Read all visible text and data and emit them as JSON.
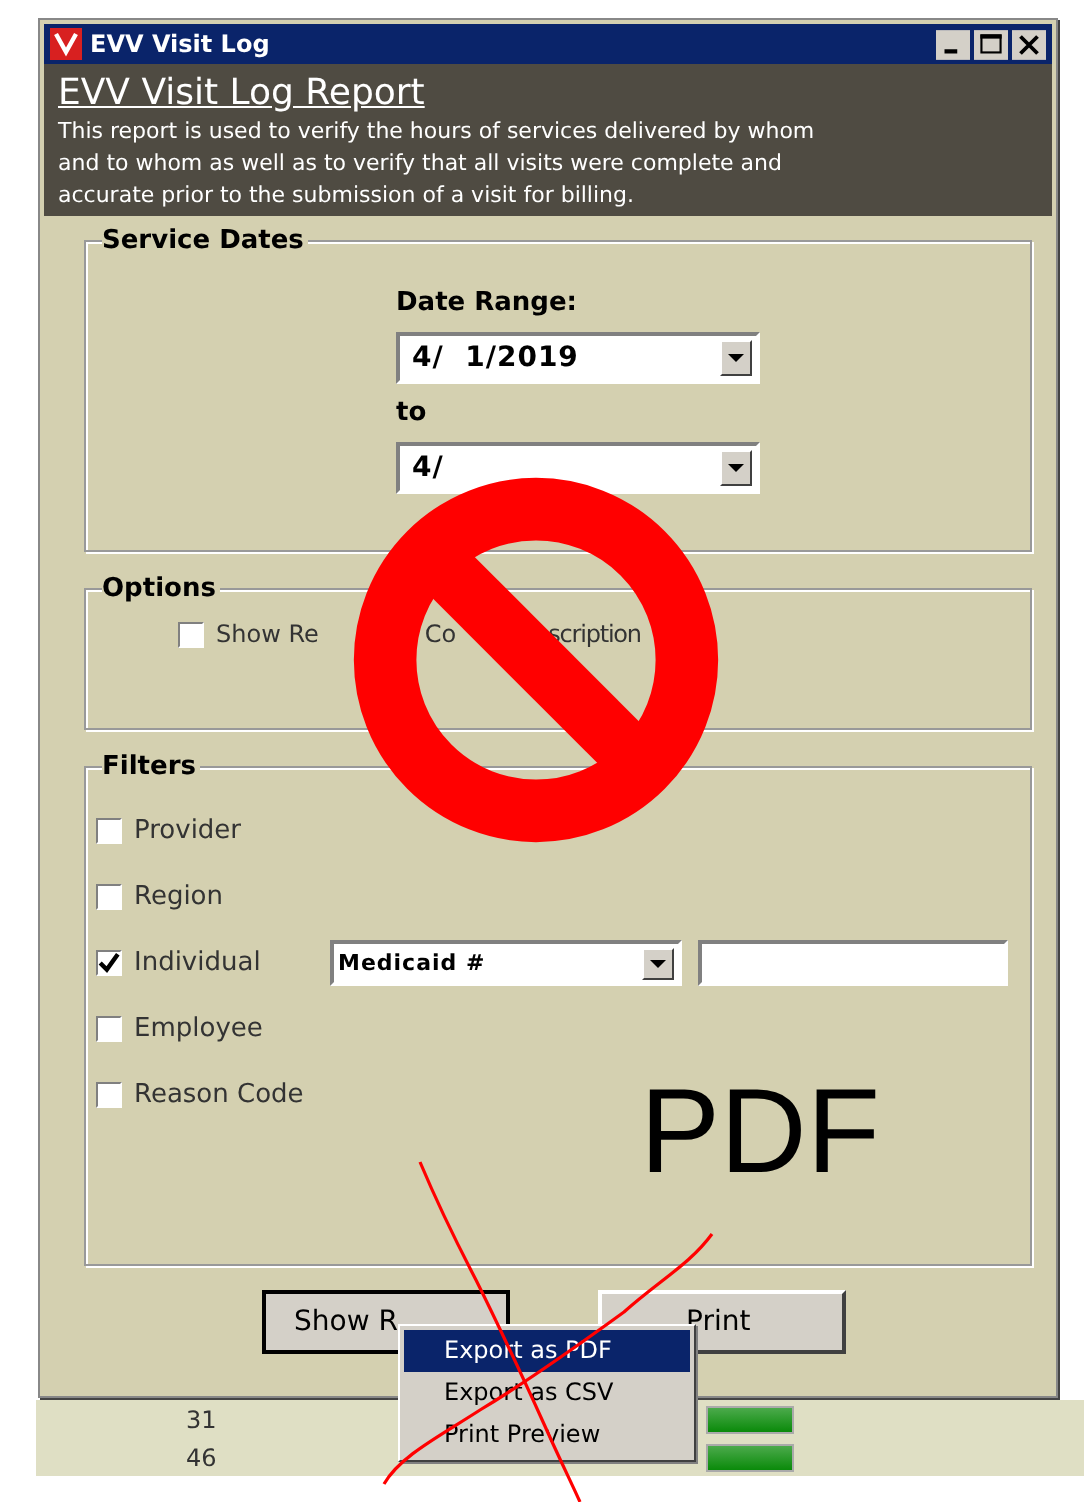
{
  "window": {
    "title": "EVV Visit Log"
  },
  "header": {
    "title": "EVV Visit Log Report",
    "description": "This report is used to verify the hours of services delivered by whom and to whom as well as to verify that all visits were complete and accurate prior to the submission of a visit for billing."
  },
  "service_dates": {
    "title": "Service Dates",
    "range_label": "Date Range:",
    "to_label": "to",
    "dates": [
      {
        "value": "4/  1/2019"
      },
      {
        "value": "4/"
      }
    ]
  },
  "options": {
    "title": "Options",
    "items": [
      {
        "label_parts": [
          "Show Re",
          "Co",
          "scription"
        ],
        "checked": false
      }
    ]
  },
  "filters": {
    "title": "Filters",
    "items": [
      {
        "label": "Provider",
        "checked": false
      },
      {
        "label": "Region",
        "checked": false
      },
      {
        "label": "Individual",
        "checked": true,
        "select": "Medicaid #"
      },
      {
        "label": "Employee",
        "checked": false
      },
      {
        "label": "Reason Code",
        "checked": false
      }
    ]
  },
  "buttons": [
    {
      "label": "Show R"
    },
    {
      "label": "Print"
    }
  ],
  "context_menu": [
    {
      "label": "Export as PDF",
      "selected": true
    },
    {
      "label": "Export as CSV",
      "selected": false
    },
    {
      "label": "Print Preview",
      "selected": false
    }
  ],
  "background_rows": [
    {
      "value": "31"
    },
    {
      "value": "46"
    }
  ],
  "annotation": {
    "text": "PDF"
  }
}
